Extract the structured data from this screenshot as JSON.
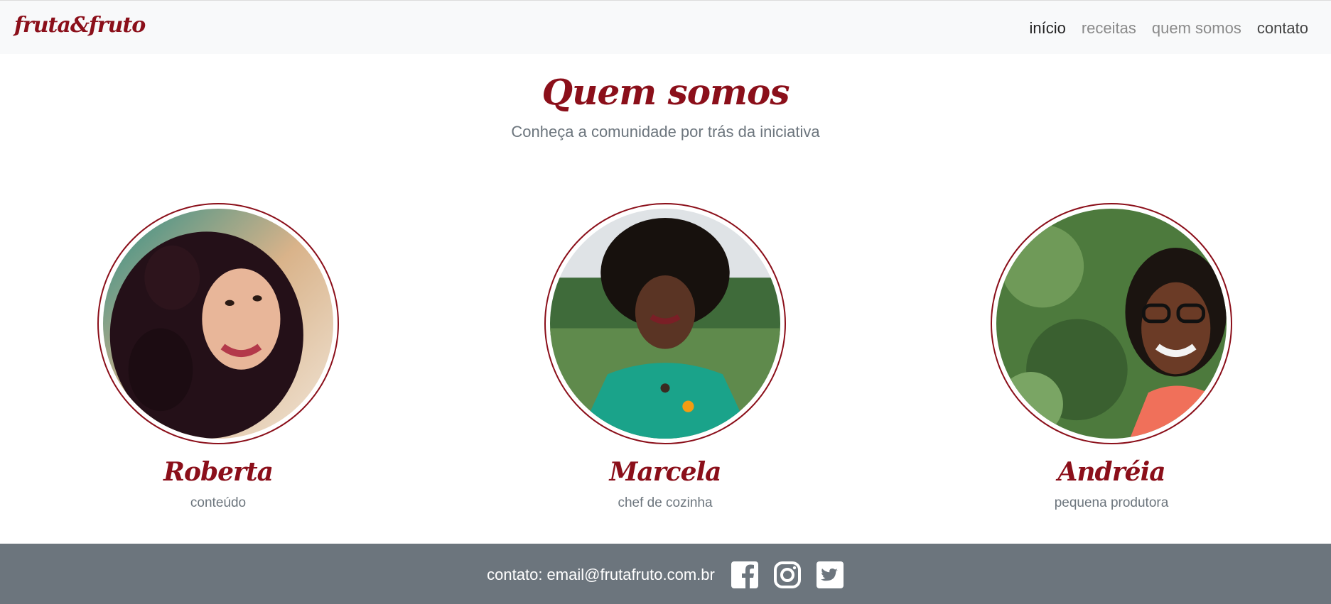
{
  "brand": {
    "name": "fruta&fruto",
    "color": "#8b0f1a"
  },
  "nav": {
    "items": [
      {
        "label": "início",
        "active": true
      },
      {
        "label": "receitas",
        "active": false
      },
      {
        "label": "quem somos",
        "active": false
      },
      {
        "label": "contato",
        "active": false
      }
    ]
  },
  "hero": {
    "title": "Quem somos",
    "subtitle": "Conheça a comunidade por trás da iniciativa"
  },
  "members": [
    {
      "name": "Roberta",
      "role": "conteúdo"
    },
    {
      "name": "Marcela",
      "role": "chef de cozinha"
    },
    {
      "name": "Andréia",
      "role": "pequena produtora"
    }
  ],
  "footer": {
    "contact_text": "contato: email@frutafruto.com.br",
    "social": [
      "facebook-icon",
      "instagram-icon",
      "twitter-icon"
    ],
    "background": "#6c757d"
  }
}
